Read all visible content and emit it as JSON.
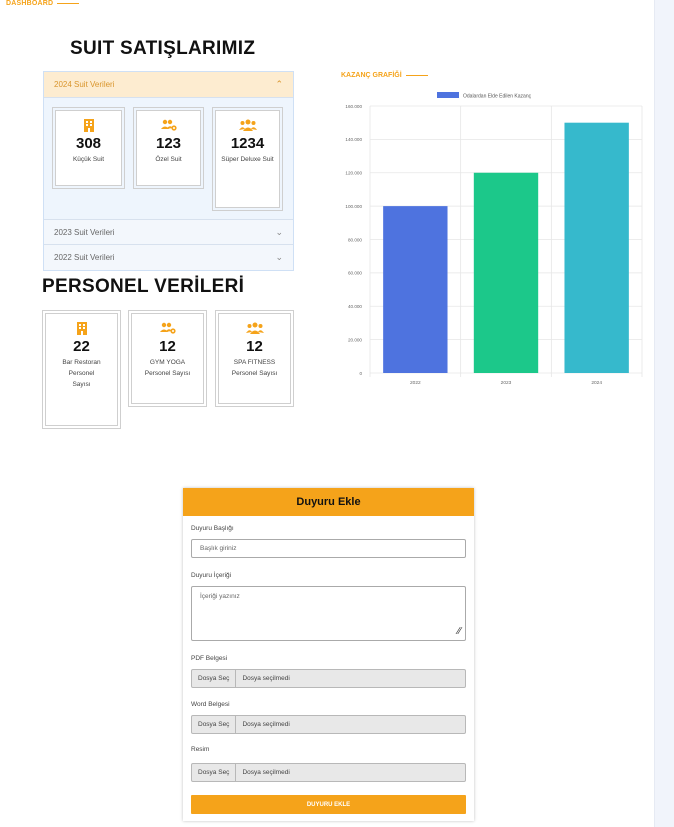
{
  "header": {
    "dashboard_label": "DASHBOARD"
  },
  "suit": {
    "title": "SUIT SATIŞLARIMIZ",
    "accordion": [
      {
        "label": "2024 Suit Verileri",
        "open": true
      },
      {
        "label": "2023 Suit Verileri",
        "open": false
      },
      {
        "label": "2022 Suit Verileri",
        "open": false
      }
    ],
    "cards": [
      {
        "icon": "hotel-icon",
        "value": "308",
        "label": "Küçük Suit"
      },
      {
        "icon": "users-cog-icon",
        "value": "123",
        "label": "Özel Suit"
      },
      {
        "icon": "users-icon",
        "value": "1234",
        "label": "Süper Deluxe Suit"
      }
    ]
  },
  "personel": {
    "title": "PERSONEL VERİLERİ",
    "cards": [
      {
        "icon": "hotel-icon",
        "value": "22",
        "label": "Bar Restoran Personel Sayısı"
      },
      {
        "icon": "users-cog-icon",
        "value": "12",
        "label": "GYM YOGA Personel Sayısı"
      },
      {
        "icon": "users-icon",
        "value": "12",
        "label": "SPA FITNESS Personel Sayısı"
      }
    ]
  },
  "chart_section": {
    "label": "KAZANÇ GRAFİĞİ"
  },
  "chart_data": {
    "type": "bar",
    "title": "",
    "legend": "Odalardan Elde Edilen Kazanç",
    "legend_position": "top",
    "categories": [
      "2022",
      "2023",
      "2024"
    ],
    "values": [
      100000,
      120000,
      150000
    ],
    "colors": [
      "#4e73df",
      "#1cc88a",
      "#36b9cc"
    ],
    "ylim": [
      0,
      160000
    ],
    "yticks": [
      "0",
      "20.000",
      "40.000",
      "60.000",
      "80.000",
      "100.000",
      "120.000",
      "140.000",
      "160.000"
    ],
    "grid": true
  },
  "form": {
    "title": "Duyuru Ekle",
    "title_label": "Duyuru Başlığı",
    "title_placeholder": "Başlık giriniz",
    "content_label": "Duyuru İçeriği",
    "content_placeholder": "İçeriği yazınız",
    "pdf_label": "PDF Belgesi",
    "word_label": "Word Belgesi",
    "image_label": "Resim",
    "file_button": "Dosya Seç",
    "file_none": "Dosya seçilmedi",
    "submit": "DUYURU EKLE"
  },
  "colors": {
    "accent": "#f5a31a"
  }
}
